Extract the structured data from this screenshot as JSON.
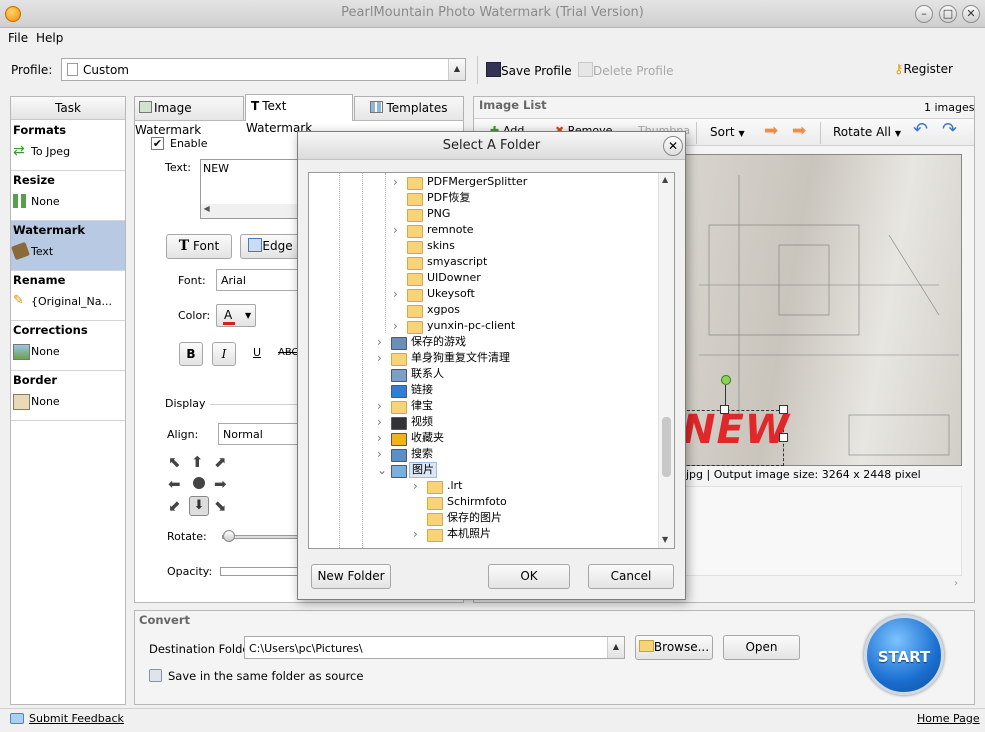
{
  "window": {
    "title": "PearlMountain Photo Watermark (Trial Version)"
  },
  "menu": [
    "File",
    "Help"
  ],
  "profile": {
    "label": "Profile:",
    "value": "Custom",
    "save": "Save Profile",
    "delete": "Delete Profile",
    "register": "Register"
  },
  "task": {
    "header": "Task",
    "sections": [
      {
        "title": "Formats",
        "value": "To Jpeg",
        "icon": "convert-icon"
      },
      {
        "title": "Resize",
        "value": "None",
        "icon": "resize-icon"
      },
      {
        "title": "Watermark",
        "value": "Text",
        "icon": "watermark-icon"
      },
      {
        "title": "Rename",
        "value": "{Original_Na...",
        "icon": "pencil-icon"
      },
      {
        "title": "Corrections",
        "value": "None",
        "icon": "image-icon"
      },
      {
        "title": "Border",
        "value": "None",
        "icon": "portrait-icon"
      }
    ]
  },
  "tabs": [
    "Image Watermark",
    "Text Watermark",
    "Templates"
  ],
  "watermark": {
    "enable": "Enable",
    "text_label": "Text:",
    "text_value": "NEW",
    "font_btn": "Font",
    "edge_btn": "Edge",
    "font_label": "Font:",
    "font_value": "Arial",
    "color_label": "Color:",
    "color_value": "A",
    "bold": "B",
    "italic": "I",
    "underline": "U",
    "strike": "ABC",
    "display": "Display",
    "align_label": "Align:",
    "align_value": "Normal",
    "rotate_label": "Rotate:",
    "opacity_label": "Opacity:"
  },
  "imagelist": {
    "title": "Image List",
    "count": "1 images",
    "add": "Add",
    "remove": "Remove",
    "thumb": "Thumbna",
    "sort": "Sort",
    "rotate_all": "Rotate All",
    "info": "jpg | Output image size: 3264 x 2448 pixel",
    "watermark_text": "NEW"
  },
  "convert": {
    "title": "Convert",
    "dest_label": "Destination Folder:",
    "dest_value": "C:\\Users\\pc\\Pictures\\",
    "browse": "Browse...",
    "open": "Open",
    "same_folder": "Save in the same folder as source",
    "start": "START"
  },
  "status": {
    "feedback": "Submit Feedback",
    "home": "Home Page"
  },
  "dialog": {
    "title": "Select A Folder",
    "new_folder": "New Folder",
    "ok": "OK",
    "cancel": "Cancel",
    "items": [
      {
        "label": "PDFMergerSplitter",
        "level": 0,
        "expander": true,
        "icon": "folder"
      },
      {
        "label": "PDF恢复",
        "level": 0,
        "expander": false,
        "icon": "folder"
      },
      {
        "label": "PNG",
        "level": 0,
        "expander": false,
        "icon": "folder"
      },
      {
        "label": "remnote",
        "level": 0,
        "expander": true,
        "icon": "folder"
      },
      {
        "label": "skins",
        "level": 0,
        "expander": false,
        "icon": "folder"
      },
      {
        "label": "smyascript",
        "level": 0,
        "expander": false,
        "icon": "folder"
      },
      {
        "label": "UIDowner",
        "level": 0,
        "expander": false,
        "icon": "folder"
      },
      {
        "label": "Ukeysoft",
        "level": 0,
        "expander": true,
        "icon": "folder"
      },
      {
        "label": "xgpos",
        "level": 0,
        "expander": false,
        "icon": "folder"
      },
      {
        "label": "yunxin-pc-client",
        "level": 0,
        "expander": true,
        "icon": "folder"
      },
      {
        "label": "保存的游戏",
        "level": -1,
        "expander": true,
        "icon": "games"
      },
      {
        "label": "单身狗重复文件清理",
        "level": -1,
        "expander": true,
        "icon": "folder"
      },
      {
        "label": "联系人",
        "level": -1,
        "expander": false,
        "icon": "contacts"
      },
      {
        "label": "链接",
        "level": -1,
        "expander": false,
        "icon": "link"
      },
      {
        "label": "律宝",
        "level": -1,
        "expander": true,
        "icon": "folder"
      },
      {
        "label": "视频",
        "level": -1,
        "expander": true,
        "icon": "video"
      },
      {
        "label": "收藏夹",
        "level": -1,
        "expander": true,
        "icon": "star"
      },
      {
        "label": "搜索",
        "level": -1,
        "expander": true,
        "icon": "search"
      },
      {
        "label": "图片",
        "level": -1,
        "expander": "open",
        "icon": "pictures",
        "selected": true
      },
      {
        "label": ".lrt",
        "level": 1,
        "expander": true,
        "icon": "folder"
      },
      {
        "label": "Schirmfoto",
        "level": 1,
        "expander": false,
        "icon": "folder"
      },
      {
        "label": "保存的图片",
        "level": 1,
        "expander": false,
        "icon": "folder"
      },
      {
        "label": "本机照片",
        "level": 1,
        "expander": true,
        "icon": "folder"
      }
    ]
  }
}
